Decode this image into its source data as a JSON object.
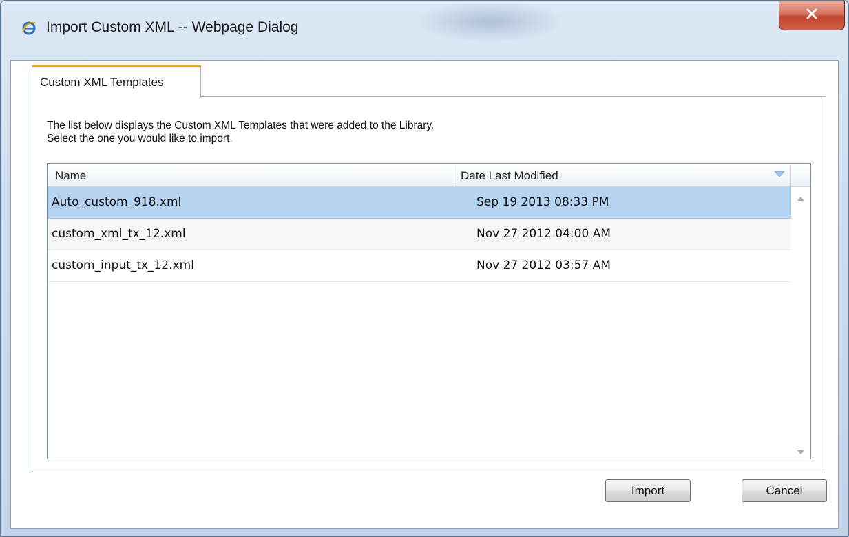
{
  "window": {
    "title": "Import Custom XML -- Webpage Dialog",
    "app_icon": "ie-icon",
    "close_icon": "close-icon"
  },
  "tab": {
    "label": "Custom XML Templates"
  },
  "description": {
    "line1": "The list below displays the Custom XML Templates that were added to the Library.",
    "line2": "Select the one you would like to import."
  },
  "grid": {
    "columns": {
      "name": "Name",
      "date": "Date Last Modified"
    },
    "rows": [
      {
        "name": "Auto_custom_918.xml",
        "date": "Sep 19 2013 08:33 PM",
        "selected": true
      },
      {
        "name": "custom_xml_tx_12.xml",
        "date": "Nov 27 2012 04:00 AM",
        "selected": false
      },
      {
        "name": "custom_input_tx_12.xml",
        "date": "Nov 27 2012 03:57 AM",
        "selected": false
      }
    ]
  },
  "buttons": {
    "import": "Import",
    "cancel": "Cancel"
  },
  "colors": {
    "selected_row": "#b7d3f2",
    "tab_accent": "#f3a60a",
    "close_button": "#c0432d"
  }
}
